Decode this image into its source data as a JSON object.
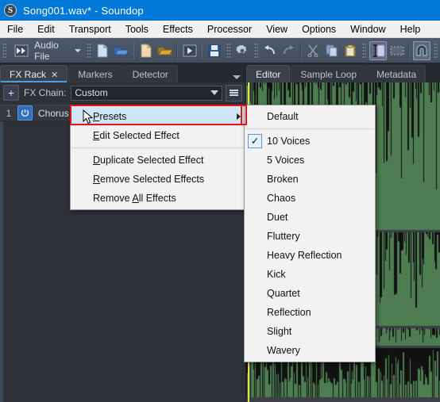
{
  "window": {
    "title": "Song001.wav* - Soundop",
    "app_icon": "soundop-logo-icon",
    "icon_letter": "S",
    "titlebar_color": "#0078d7"
  },
  "menubar": {
    "items": [
      {
        "label": "File"
      },
      {
        "label": "Edit"
      },
      {
        "label": "Transport"
      },
      {
        "label": "Tools"
      },
      {
        "label": "Effects"
      },
      {
        "label": "Processor"
      },
      {
        "label": "View"
      },
      {
        "label": "Options"
      },
      {
        "label": "Window"
      },
      {
        "label": "Help"
      }
    ]
  },
  "toolbar": {
    "mode_label": "Audio File",
    "buttons": [
      {
        "name": "fast-forward-icon"
      },
      {
        "name": "new-file-icon"
      },
      {
        "name": "open-file-icon"
      },
      {
        "name": "new-session-icon"
      },
      {
        "name": "open-session-icon"
      },
      {
        "name": "play-icon"
      },
      {
        "name": "save-icon"
      },
      {
        "name": "settings-gear-icon"
      },
      {
        "name": "undo-icon"
      },
      {
        "name": "redo-icon"
      },
      {
        "name": "cut-scissors-icon"
      },
      {
        "name": "copy-icon"
      },
      {
        "name": "paste-icon"
      },
      {
        "name": "text-cursor-tool-icon"
      },
      {
        "name": "marquee-select-icon"
      },
      {
        "name": "magnet-snap-icon"
      }
    ]
  },
  "left_pane": {
    "tabs": [
      {
        "label": "FX Rack",
        "selected": true,
        "closable": true
      },
      {
        "label": "Markers",
        "selected": false,
        "closable": false
      },
      {
        "label": "Detector",
        "selected": false,
        "closable": false
      }
    ],
    "close_glyph": "✕",
    "fx_chain": {
      "add_label": "+",
      "label": "FX Chain:",
      "value": "Custom"
    },
    "effects": [
      {
        "index": "1",
        "name": "Chorus",
        "enabled": true
      }
    ]
  },
  "right_pane": {
    "tabs": [
      {
        "label": "Editor",
        "selected": true
      },
      {
        "label": "Sample Loop",
        "selected": false
      },
      {
        "label": "Metadata",
        "selected": false
      }
    ],
    "waveform": {
      "fill_color": "#4e7d52",
      "spike_color": "#111111",
      "background": "#1b1d21",
      "playhead_color": "#e8e14a"
    }
  },
  "context_menu": {
    "items": [
      {
        "label": "Presets",
        "accel": "P",
        "submenu": true,
        "highlighted": true,
        "annotated": true
      },
      {
        "label": "Edit Selected Effect",
        "accel": "E",
        "submenu": false
      },
      {
        "separator": true
      },
      {
        "label": "Duplicate Selected Effect",
        "accel": "D",
        "submenu": false
      },
      {
        "label": "Remove Selected Effects",
        "accel": "R",
        "submenu": false
      },
      {
        "label": "Remove All Effects",
        "accel": "A",
        "submenu": false
      }
    ]
  },
  "presets_submenu": {
    "items": [
      {
        "label": "Default",
        "checked": false
      },
      {
        "separator": true
      },
      {
        "label": "10 Voices",
        "checked": true
      },
      {
        "label": "5 Voices",
        "checked": false
      },
      {
        "label": "Broken",
        "checked": false
      },
      {
        "label": "Chaos",
        "checked": false
      },
      {
        "label": "Duet",
        "checked": false
      },
      {
        "label": "Fluttery",
        "checked": false
      },
      {
        "label": "Heavy Reflection",
        "checked": false
      },
      {
        "label": "Kick",
        "checked": false
      },
      {
        "label": "Quartet",
        "checked": false
      },
      {
        "label": "Reflection",
        "checked": false
      },
      {
        "label": "Slight",
        "checked": false
      },
      {
        "label": "Wavery",
        "checked": false
      }
    ],
    "check_glyph": "✓"
  },
  "annotation": {
    "box_color": "#ee1111"
  }
}
